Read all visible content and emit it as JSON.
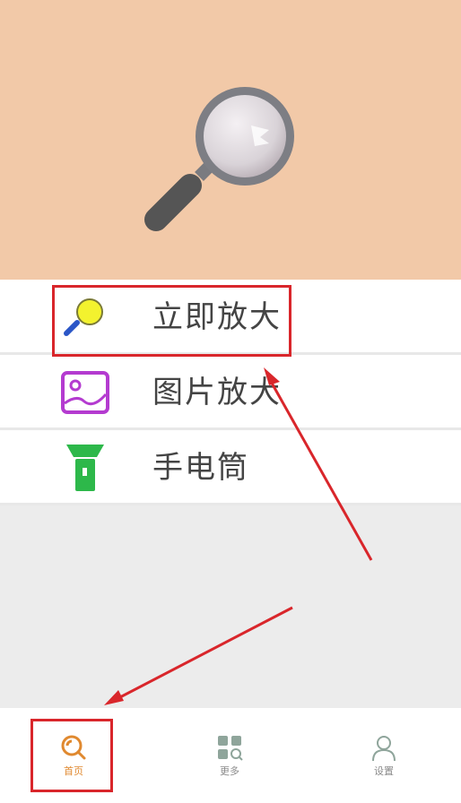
{
  "hero": {
    "icon": "magnifier-icon"
  },
  "menu": {
    "items": [
      {
        "label": "立即放大",
        "icon": "magnifier-small-icon"
      },
      {
        "label": "图片放大",
        "icon": "image-icon"
      },
      {
        "label": "手电筒",
        "icon": "flashlight-icon"
      }
    ]
  },
  "tabs": [
    {
      "label": "首页",
      "icon": "search-icon",
      "active": true
    },
    {
      "label": "更多",
      "icon": "grid-icon",
      "active": false
    },
    {
      "label": "设置",
      "icon": "user-icon",
      "active": false
    }
  ],
  "colors": {
    "hero_bg": "#f2c9a8",
    "accent": "#e0892f",
    "annotation": "#d9262b"
  }
}
